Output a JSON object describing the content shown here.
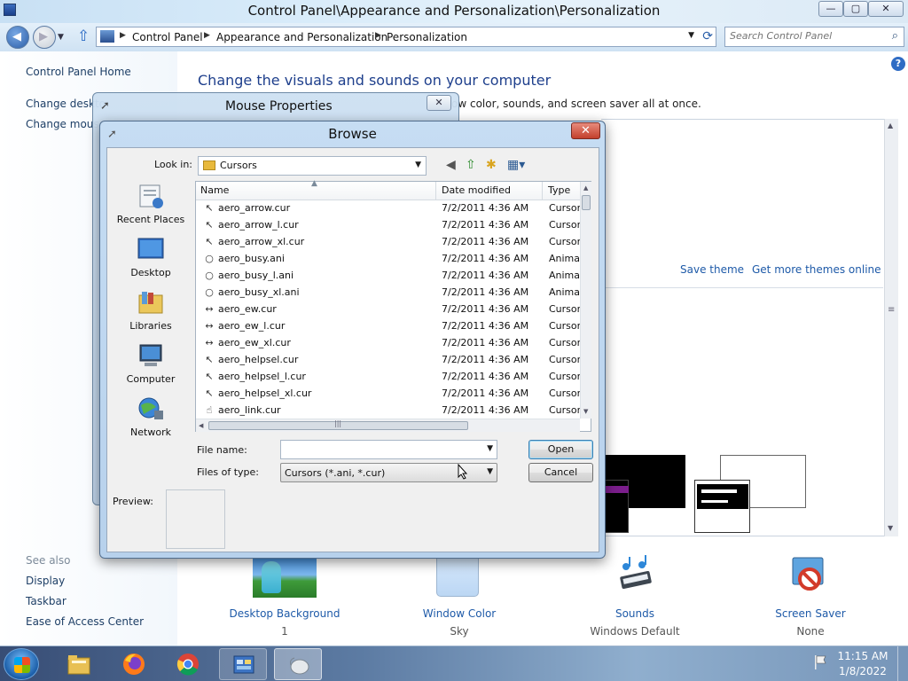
{
  "control_panel": {
    "title": "Control Panel\\Appearance and Personalization\\Personalization",
    "caption_buttons": {
      "minimize": "—",
      "maximize": "▢",
      "close": "✕"
    },
    "breadcrumbs": [
      "Control Panel",
      "Appearance and Personalization",
      "Personalization"
    ],
    "search_placeholder": "Search Control Panel",
    "sidebar": {
      "home": "Control Panel Home",
      "links": [
        "Change deskto",
        "Change mous"
      ],
      "see_also": "See also",
      "see_also_links": [
        "Display",
        "Taskbar",
        "Ease of Access Center"
      ]
    },
    "main": {
      "heading": "Change the visuals and sounds on your computer",
      "subtext": "ow color, sounds, and screen saver all at once.",
      "save_theme": "Save theme",
      "get_more_themes": "Get more themes online",
      "help_icon": "?"
    },
    "bottom_items": [
      {
        "label": "Desktop Background",
        "value": "1"
      },
      {
        "label": "Window Color",
        "value": "Sky"
      },
      {
        "label": "Sounds",
        "value": "Windows Default"
      },
      {
        "label": "Screen Saver",
        "value": "None"
      }
    ]
  },
  "mouse_properties": {
    "title": "Mouse Properties",
    "close": "✕"
  },
  "browse": {
    "title": "Browse",
    "close": "✕",
    "look_in_label": "Look in:",
    "look_in_value": "Cursors",
    "places": [
      "Recent Places",
      "Desktop",
      "Libraries",
      "Computer",
      "Network"
    ],
    "columns": [
      "Name",
      "Date modified",
      "Type"
    ],
    "files": [
      {
        "name": "aero_arrow.cur",
        "date": "7/2/2011 4:36 AM",
        "type": "Cursor",
        "icon": "↖"
      },
      {
        "name": "aero_arrow_l.cur",
        "date": "7/2/2011 4:36 AM",
        "type": "Cursor",
        "icon": "↖"
      },
      {
        "name": "aero_arrow_xl.cur",
        "date": "7/2/2011 4:36 AM",
        "type": "Cursor",
        "icon": "↖"
      },
      {
        "name": "aero_busy.ani",
        "date": "7/2/2011 4:36 AM",
        "type": "Anima",
        "icon": "○"
      },
      {
        "name": "aero_busy_l.ani",
        "date": "7/2/2011 4:36 AM",
        "type": "Anima",
        "icon": "○"
      },
      {
        "name": "aero_busy_xl.ani",
        "date": "7/2/2011 4:36 AM",
        "type": "Anima",
        "icon": "○"
      },
      {
        "name": "aero_ew.cur",
        "date": "7/2/2011 4:36 AM",
        "type": "Cursor",
        "icon": "↔"
      },
      {
        "name": "aero_ew_l.cur",
        "date": "7/2/2011 4:36 AM",
        "type": "Cursor",
        "icon": "↔"
      },
      {
        "name": "aero_ew_xl.cur",
        "date": "7/2/2011 4:36 AM",
        "type": "Cursor",
        "icon": "↔"
      },
      {
        "name": "aero_helpsel.cur",
        "date": "7/2/2011 4:36 AM",
        "type": "Cursor",
        "icon": "↖"
      },
      {
        "name": "aero_helpsel_l.cur",
        "date": "7/2/2011 4:36 AM",
        "type": "Cursor",
        "icon": "↖"
      },
      {
        "name": "aero_helpsel_xl.cur",
        "date": "7/2/2011 4:36 AM",
        "type": "Cursor",
        "icon": "↖"
      },
      {
        "name": "aero_link.cur",
        "date": "7/2/2011 4:36 AM",
        "type": "Cursor",
        "icon": "☝"
      }
    ],
    "file_name_label": "File name:",
    "file_name_value": "",
    "files_of_type_label": "Files of type:",
    "files_of_type_value": "Cursors (*.ani, *.cur)",
    "open_label": "Open",
    "cancel_label": "Cancel",
    "preview_label": "Preview:"
  },
  "taskbar": {
    "time": "11:15 AM",
    "date": "1/8/2022"
  }
}
